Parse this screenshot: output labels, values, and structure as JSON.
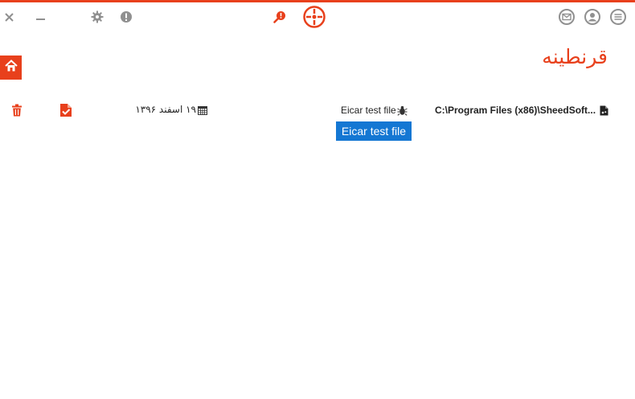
{
  "window": {
    "title": "قرنطینه",
    "accent_color": "#e8401c",
    "titlebar_icons": [
      "close-icon",
      "minimize-icon",
      "gear-icon",
      "info-icon",
      "scan-alert-icon",
      "target-logo-icon",
      "mail-icon",
      "user-icon",
      "menu-icon"
    ]
  },
  "quarantine": {
    "items": [
      {
        "path": "C:\\Program Files (x86)\\SheedSoft...",
        "threat": "Eicar test file",
        "date": "۱۹ اسفند ۱۳۹۶",
        "tooltip": "Eicar test file"
      }
    ]
  },
  "tooltip_color": "#1477d3"
}
